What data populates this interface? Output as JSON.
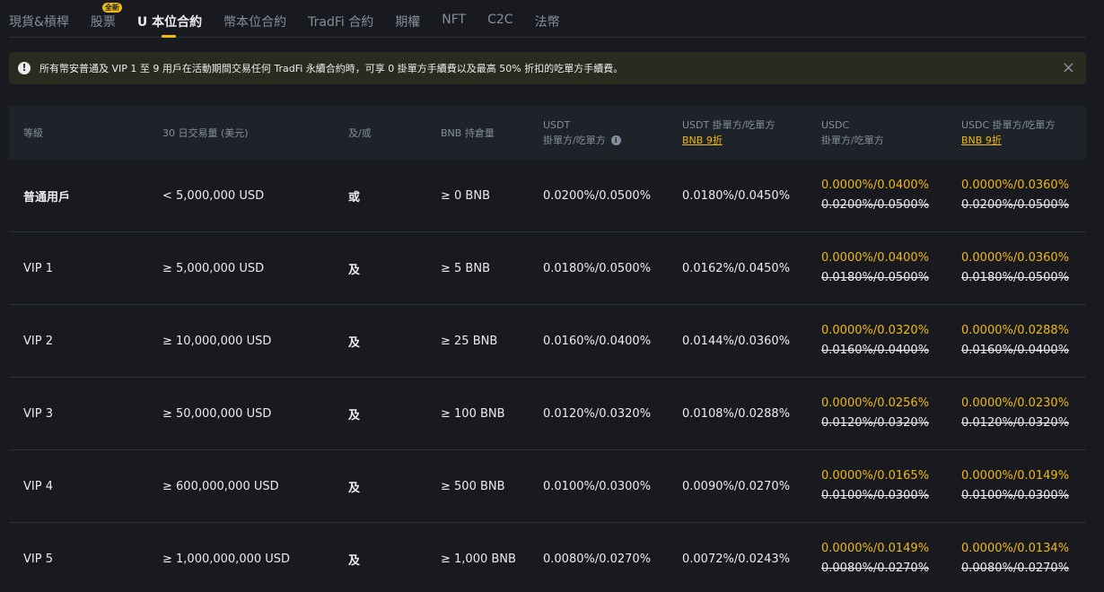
{
  "tabs": [
    {
      "label": "現貨&槓桿",
      "badge": null,
      "active": false
    },
    {
      "label": "股票",
      "badge": "全新",
      "active": false
    },
    {
      "label": "U 本位合約",
      "badge": null,
      "active": true
    },
    {
      "label": "幣本位合約",
      "badge": null,
      "active": false
    },
    {
      "label": "TradFi 合約",
      "badge": null,
      "active": false
    },
    {
      "label": "期權",
      "badge": null,
      "active": false
    },
    {
      "label": "NFT",
      "badge": null,
      "active": false
    },
    {
      "label": "C2C",
      "badge": null,
      "active": false
    },
    {
      "label": "法幣",
      "badge": null,
      "active": false
    }
  ],
  "notice": {
    "text": "所有幣安普通及 VIP 1 至 9 用戶在活動期間交易任何 TradFi 永續合約時，可享 0 掛單方手續費以及最高 50% 折扣的吃單方手續費。",
    "icon": "exclamation-icon",
    "close": "×"
  },
  "table": {
    "headers": {
      "tier": "等級",
      "volume": "30 日交易量 (美元)",
      "andor": "及/或",
      "bnb": "BNB 持倉量",
      "usdt_line1": "USDT",
      "usdt_line2": "掛單方/吃單方",
      "usdt_bnb_line1": "USDT 掛單方/吃單方",
      "usdt_bnb_link": "BNB 9折",
      "usdc_line1": "USDC",
      "usdc_line2": "掛單方/吃單方",
      "usdc_bnb_line1": "USDC 掛單方/吃單方",
      "usdc_bnb_link": "BNB 9折"
    },
    "rows": [
      {
        "tier": "普通用戶",
        "volume": "< 5,000,000 USD",
        "andor": "或",
        "bnb": "≥ 0 BNB",
        "usdt": "0.0200%/0.0500%",
        "usdt_bnb": "0.0180%/0.0450%",
        "usdc_promo": "0.0000%/0.0400%",
        "usdc_old": "0.0200%/0.0500%",
        "usdc_bnb_promo": "0.0000%/0.0360%",
        "usdc_bnb_old": "0.0200%/0.0500%"
      },
      {
        "tier": "VIP 1",
        "volume": "≥ 5,000,000 USD",
        "andor": "及",
        "bnb": "≥ 5 BNB",
        "usdt": "0.0180%/0.0500%",
        "usdt_bnb": "0.0162%/0.0450%",
        "usdc_promo": "0.0000%/0.0400%",
        "usdc_old": "0.0180%/0.0500%",
        "usdc_bnb_promo": "0.0000%/0.0360%",
        "usdc_bnb_old": "0.0180%/0.0500%"
      },
      {
        "tier": "VIP 2",
        "volume": "≥ 10,000,000 USD",
        "andor": "及",
        "bnb": "≥ 25 BNB",
        "usdt": "0.0160%/0.0400%",
        "usdt_bnb": "0.0144%/0.0360%",
        "usdc_promo": "0.0000%/0.0320%",
        "usdc_old": "0.0160%/0.0400%",
        "usdc_bnb_promo": "0.0000%/0.0288%",
        "usdc_bnb_old": "0.0160%/0.0400%"
      },
      {
        "tier": "VIP 3",
        "volume": "≥ 50,000,000 USD",
        "andor": "及",
        "bnb": "≥ 100 BNB",
        "usdt": "0.0120%/0.0320%",
        "usdt_bnb": "0.0108%/0.0288%",
        "usdc_promo": "0.0000%/0.0256%",
        "usdc_old": "0.0120%/0.0320%",
        "usdc_bnb_promo": "0.0000%/0.0230%",
        "usdc_bnb_old": "0.0120%/0.0320%"
      },
      {
        "tier": "VIP 4",
        "volume": "≥ 600,000,000 USD",
        "andor": "及",
        "bnb": "≥ 500 BNB",
        "usdt": "0.0100%/0.0300%",
        "usdt_bnb": "0.0090%/0.0270%",
        "usdc_promo": "0.0000%/0.0165%",
        "usdc_old": "0.0100%/0.0300%",
        "usdc_bnb_promo": "0.0000%/0.0149%",
        "usdc_bnb_old": "0.0100%/0.0300%"
      },
      {
        "tier": "VIP 5",
        "volume": "≥ 1,000,000,000 USD",
        "andor": "及",
        "bnb": "≥ 1,000 BNB",
        "usdt": "0.0080%/0.0270%",
        "usdt_bnb": "0.0072%/0.0243%",
        "usdc_promo": "0.0000%/0.0149%",
        "usdc_old": "0.0080%/0.0270%",
        "usdc_bnb_promo": "0.0000%/0.0134%",
        "usdc_bnb_old": "0.0080%/0.0270%"
      }
    ]
  },
  "colors": {
    "accent": "#f0b90b",
    "background": "#181a20",
    "muted": "#848e9c"
  }
}
